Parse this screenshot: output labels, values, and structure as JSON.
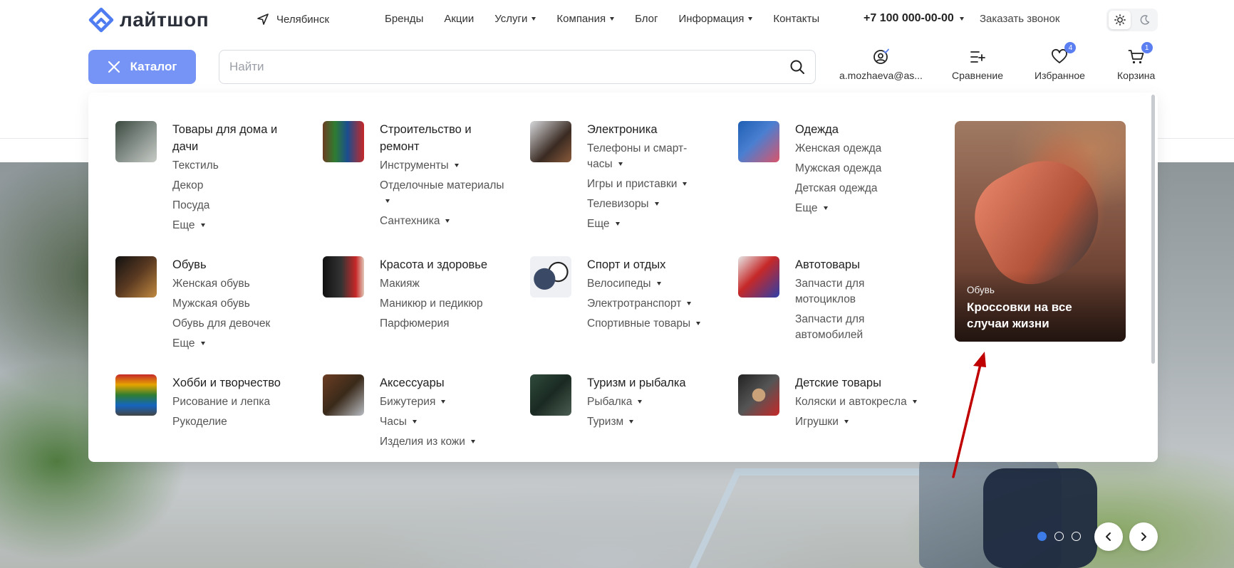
{
  "header": {
    "logo_text": "лайтшоп",
    "city": "Челябинск",
    "nav": [
      {
        "label": "Бренды",
        "has_dropdown": false
      },
      {
        "label": "Акции",
        "has_dropdown": false
      },
      {
        "label": "Услуги",
        "has_dropdown": true
      },
      {
        "label": "Компания",
        "has_dropdown": true
      },
      {
        "label": "Блог",
        "has_dropdown": false
      },
      {
        "label": "Информация",
        "has_dropdown": true
      },
      {
        "label": "Контакты",
        "has_dropdown": false
      }
    ],
    "phone": "+7 100 000-00-00",
    "callback": "Заказать звонок",
    "theme": {
      "active": "light"
    }
  },
  "toolbar": {
    "catalog_label": "Каталог",
    "search_placeholder": "Найти",
    "user_label": "a.mozhaeva@as...",
    "compare_label": "Сравнение",
    "favorites_label": "Избранное",
    "favorites_count": "4",
    "cart_label": "Корзина",
    "cart_count": "1"
  },
  "catalog": {
    "categories": [
      {
        "title": "Товары для дома и дачи",
        "icon": "home-goods-icon",
        "links": [
          {
            "label": "Текстиль",
            "more": false
          },
          {
            "label": "Декор",
            "more": false
          },
          {
            "label": "Посуда",
            "more": false
          },
          {
            "label": "Еще",
            "more": true
          }
        ]
      },
      {
        "title": "Строительство и ремонт",
        "icon": "construction-icon",
        "links": [
          {
            "label": "Инструменты",
            "more": true
          },
          {
            "label": "Отделочные материалы",
            "more": true
          },
          {
            "label": "Сантехника",
            "more": true
          }
        ]
      },
      {
        "title": "Электроника",
        "icon": "electronics-icon",
        "links": [
          {
            "label": "Телефоны и смарт-часы",
            "more": true
          },
          {
            "label": "Игры и приставки",
            "more": true
          },
          {
            "label": "Телевизоры",
            "more": true
          },
          {
            "label": "Еще",
            "more": true
          }
        ]
      },
      {
        "title": "Одежда",
        "icon": "clothing-icon",
        "links": [
          {
            "label": "Женская одежда",
            "more": false
          },
          {
            "label": "Мужская одежда",
            "more": false
          },
          {
            "label": "Детская одежда",
            "more": false
          },
          {
            "label": "Еще",
            "more": true
          }
        ]
      },
      {
        "title": "Обувь",
        "icon": "shoes-icon",
        "links": [
          {
            "label": "Женская обувь",
            "more": false
          },
          {
            "label": "Мужская обувь",
            "more": false
          },
          {
            "label": "Обувь для девочек",
            "more": false
          },
          {
            "label": "Еще",
            "more": true
          }
        ]
      },
      {
        "title": "Красота и здоровье",
        "icon": "beauty-icon",
        "links": [
          {
            "label": "Макияж",
            "more": false
          },
          {
            "label": "Маникюр и педикюр",
            "more": false
          },
          {
            "label": "Парфюмерия",
            "more": false
          }
        ]
      },
      {
        "title": "Спорт и отдых",
        "icon": "sport-icon",
        "links": [
          {
            "label": "Велосипеды",
            "more": true
          },
          {
            "label": "Электротранспорт",
            "more": true
          },
          {
            "label": "Спортивные товары",
            "more": true
          }
        ]
      },
      {
        "title": "Автотовары",
        "icon": "auto-icon",
        "links": [
          {
            "label": "Запчасти для мотоциклов",
            "more": false
          },
          {
            "label": "Запчасти для автомобилей",
            "more": false
          }
        ]
      },
      {
        "title": "Хобби и творчество",
        "icon": "hobby-icon",
        "links": [
          {
            "label": "Рисование и лепка",
            "more": false
          },
          {
            "label": "Рукоделие",
            "more": false
          }
        ]
      },
      {
        "title": "Аксессуары",
        "icon": "accessories-icon",
        "links": [
          {
            "label": "Бижутерия",
            "more": true
          },
          {
            "label": "Часы",
            "more": true
          },
          {
            "label": "Изделия из кожи",
            "more": true
          }
        ]
      },
      {
        "title": "Туризм и рыбалка",
        "icon": "tourism-icon",
        "links": [
          {
            "label": "Рыбалка",
            "more": true
          },
          {
            "label": "Туризм",
            "more": true
          }
        ]
      },
      {
        "title": "Детские товары",
        "icon": "kids-icon",
        "links": [
          {
            "label": "Коляски и автокресла",
            "more": true
          },
          {
            "label": "Игрушки",
            "more": true
          }
        ]
      }
    ],
    "promo": {
      "category": "Обувь",
      "title": "Кроссовки на все случаи жизни"
    }
  },
  "slider": {
    "dots": 3,
    "active": 0
  },
  "colors": {
    "accent": "#7694f5",
    "badge": "#5b7ff0",
    "annotation": "#c00000"
  }
}
